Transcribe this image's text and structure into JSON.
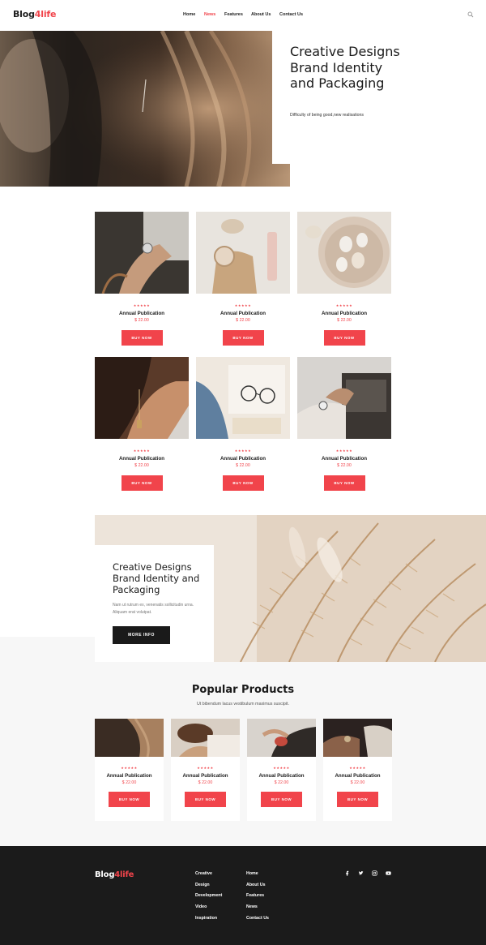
{
  "brand": {
    "name_main": "Blog",
    "name_accent": "4life"
  },
  "nav": {
    "items": [
      {
        "label": "Home",
        "active": false
      },
      {
        "label": "News",
        "active": true
      },
      {
        "label": "Features",
        "active": false
      },
      {
        "label": "About Us",
        "active": false
      },
      {
        "label": "Contact Us",
        "active": false
      }
    ],
    "search_icon": "search-icon"
  },
  "hero": {
    "title": "Creative Designs Brand Identity and Packaging",
    "subtitle": "Difficulty of being good,new realisations"
  },
  "products": [
    {
      "stars": "★★★★★",
      "title": "Annual Publication",
      "price": "$ 22.00",
      "button": "BUY NOW"
    },
    {
      "stars": "★★★★★",
      "title": "Annual Publication",
      "price": "$ 22.00",
      "button": "BUY NOW"
    },
    {
      "stars": "★★★★★",
      "title": "Annual Publication",
      "price": "$ 22.00",
      "button": "BUY NOW"
    },
    {
      "stars": "★★★★★",
      "title": "Annual Publication",
      "price": "$ 22.00",
      "button": "BUY NOW"
    },
    {
      "stars": "★★★★★",
      "title": "Annual Publication",
      "price": "$ 22.00",
      "button": "BUY NOW"
    },
    {
      "stars": "★★★★★",
      "title": "Annual Publication",
      "price": "$ 22.00",
      "button": "BUY NOW"
    }
  ],
  "feature": {
    "title": "Creative Designs Brand Identity and Packaging",
    "text": "Nam ut rutrum ex, venenatis sollicitudin urna. Aliquam erat volutpat.",
    "button": "MORE INFO"
  },
  "popular": {
    "title": "Popular Products",
    "subtitle": "Ut bibendum lacus vestibulum maximus suscipit.",
    "items": [
      {
        "stars": "★★★★★",
        "title": "Annual Publication",
        "price": "$ 22.00",
        "button": "BUY NOW"
      },
      {
        "stars": "★★★★★",
        "title": "Annual Publication",
        "price": "$ 22.00",
        "button": "BUY NOW"
      },
      {
        "stars": "★★★★★",
        "title": "Annual Publication",
        "price": "$ 22.00",
        "button": "BUY NOW"
      },
      {
        "stars": "★★★★★",
        "title": "Annual Publication",
        "price": "$ 22.00",
        "button": "BUY NOW"
      }
    ]
  },
  "footer": {
    "col1": [
      "Creative",
      "Design",
      "Development",
      "Video",
      "Inspiration"
    ],
    "col2": [
      "Home",
      "About Us",
      "Features",
      "News",
      "Contact Us"
    ],
    "social_icons": [
      "facebook-icon",
      "twitter-icon",
      "instagram-icon",
      "youtube-icon"
    ]
  },
  "colors": {
    "accent": "#f1444b",
    "dark": "#1b1b1b",
    "light_gray": "#f7f7f7"
  }
}
